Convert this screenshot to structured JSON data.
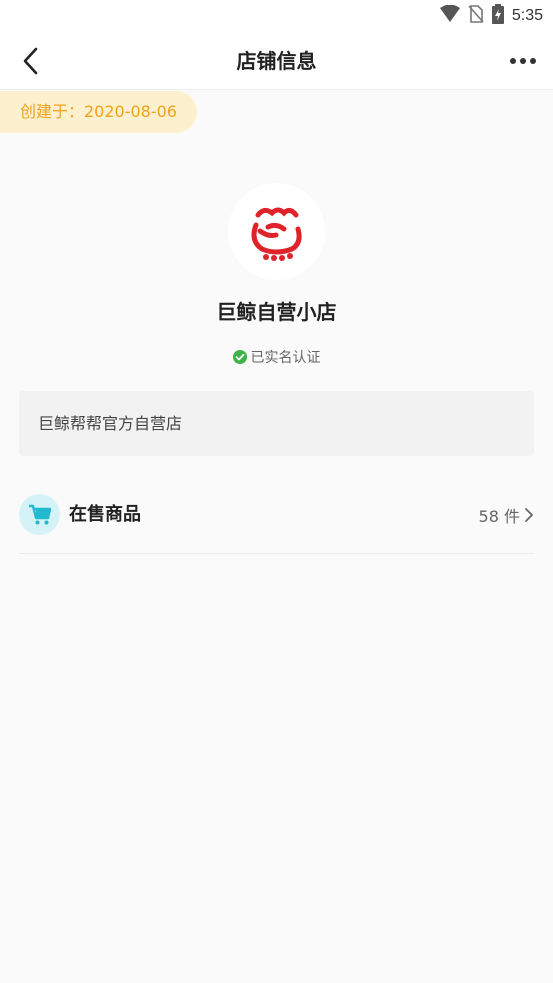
{
  "status_bar": {
    "time": "5:35",
    "icons": [
      "wifi-icon",
      "no-sim-icon",
      "battery-charging-icon"
    ]
  },
  "nav": {
    "title": "店铺信息",
    "back_icon": "chevron-left-icon",
    "more_icon": "more-dots-icon"
  },
  "created": {
    "label": "创建于：2020-08-06"
  },
  "shop": {
    "logo_icon": "whale-logo",
    "name": "巨鲸自营小店",
    "verified_label": "已实名认证",
    "description": "巨鲸帮帮官方自营店"
  },
  "goods": {
    "icon": "cart-icon",
    "label": "在售商品",
    "count": "58 件"
  },
  "colors": {
    "accent_orange": "#f0a21a",
    "pill_bg": "#fdf0cf",
    "logo_red": "#e0232b",
    "verified_green": "#3db34a",
    "cart_teal": "#22b8cf",
    "cart_bg": "#d5f3f7"
  }
}
